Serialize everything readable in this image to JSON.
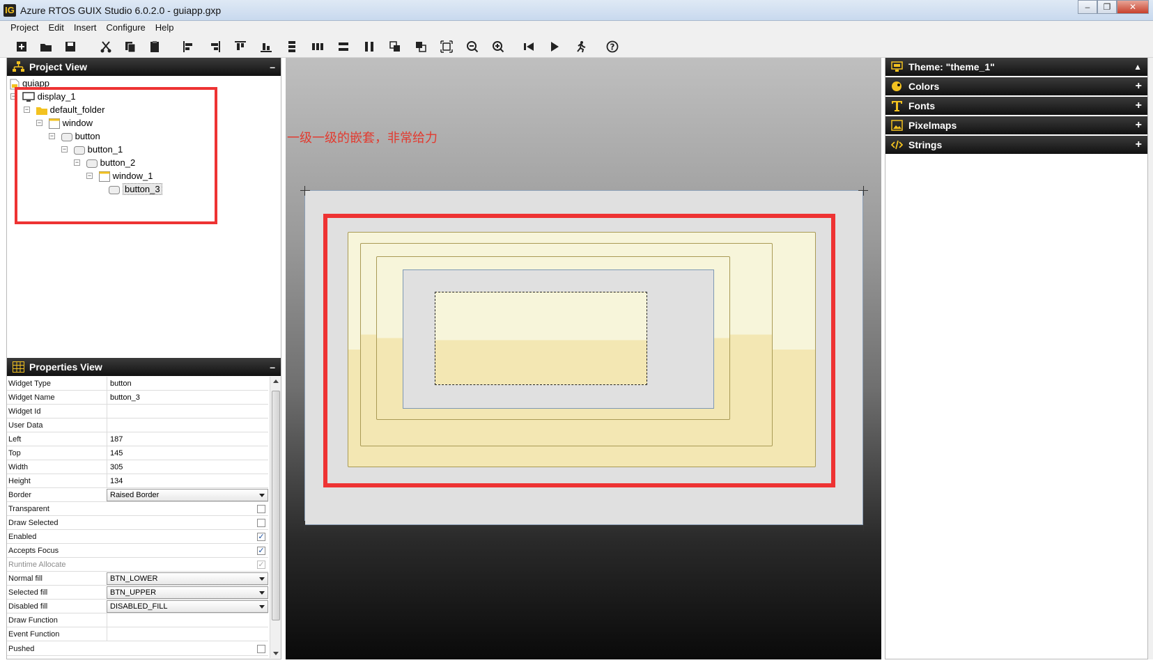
{
  "window": {
    "app_icon": "IG",
    "title": "Azure RTOS GUIX Studio 6.0.2.0 - guiapp.gxp",
    "controls": [
      "minimize",
      "restore",
      "close"
    ]
  },
  "menu": {
    "items": [
      "Project",
      "Edit",
      "Insert",
      "Configure",
      "Help"
    ]
  },
  "toolbar": {
    "buttons": [
      "new",
      "open",
      "save",
      "cut",
      "copy",
      "paste",
      "align-left",
      "align-right",
      "align-top",
      "align-bottom",
      "vspace-equally",
      "hspace-equally",
      "equal-height",
      "equal-width",
      "move-to-front",
      "move-to-back",
      "size-to-fit",
      "zoom-out",
      "zoom-in",
      "record-macro",
      "run",
      "run-app",
      "help"
    ]
  },
  "project_view": {
    "title": "Project View",
    "minimize": "–",
    "tree": [
      {
        "label": "guiapp",
        "icon": "project-icon"
      },
      {
        "label": "display_1",
        "icon": "display-icon"
      },
      {
        "label": "default_folder",
        "icon": "folder-icon"
      },
      {
        "label": "window",
        "icon": "window-icon"
      },
      {
        "label": "button",
        "icon": "button-icon"
      },
      {
        "label": "button_1",
        "icon": "button-icon"
      },
      {
        "label": "button_2",
        "icon": "button-icon"
      },
      {
        "label": "window_1",
        "icon": "window-icon"
      },
      {
        "label": "button_3",
        "icon": "button-icon"
      }
    ]
  },
  "properties_view": {
    "title": "Properties View",
    "minimize": "–",
    "rows": [
      {
        "name": "Widget Type",
        "value": "button",
        "kind": "text"
      },
      {
        "name": "Widget Name",
        "value": "button_3",
        "kind": "text"
      },
      {
        "name": "Widget Id",
        "value": "",
        "kind": "text"
      },
      {
        "name": "User Data",
        "value": "",
        "kind": "text"
      },
      {
        "name": "Left",
        "value": "187",
        "kind": "text"
      },
      {
        "name": "Top",
        "value": "145",
        "kind": "text"
      },
      {
        "name": "Width",
        "value": "305",
        "kind": "text"
      },
      {
        "name": "Height",
        "value": "134",
        "kind": "text"
      },
      {
        "name": "Border",
        "value": "Raised Border",
        "kind": "dropdown"
      },
      {
        "name": "Transparent",
        "value": "",
        "kind": "checkbox",
        "checked": false
      },
      {
        "name": "Draw Selected",
        "value": "",
        "kind": "checkbox",
        "checked": false
      },
      {
        "name": "Enabled",
        "value": "",
        "kind": "checkbox",
        "checked": true
      },
      {
        "name": "Accepts Focus",
        "value": "",
        "kind": "checkbox",
        "checked": true
      },
      {
        "name": "Runtime Allocate",
        "value": "",
        "kind": "checkbox",
        "checked": true,
        "disabled": true
      },
      {
        "name": "Normal fill",
        "value": "BTN_LOWER",
        "kind": "dropdown"
      },
      {
        "name": "Selected fill",
        "value": "BTN_UPPER",
        "kind": "dropdown"
      },
      {
        "name": "Disabled fill",
        "value": "DISABLED_FILL",
        "kind": "dropdown"
      },
      {
        "name": "Draw Function",
        "value": "",
        "kind": "text"
      },
      {
        "name": "Event Function",
        "value": "",
        "kind": "text"
      },
      {
        "name": "Pushed",
        "value": "",
        "kind": "checkbox",
        "checked": false
      }
    ]
  },
  "canvas": {
    "annotation_text": "一级一级的嵌套，非常给力",
    "annotation_color": "#e23a2f",
    "display_background": "#e0e0e0",
    "widget_upper_fill": "#f7f5da",
    "widget_lower_fill": "#f3e7b3"
  },
  "resources": {
    "theme_label": "Theme: \"theme_1\"",
    "sections": [
      {
        "label": "Colors",
        "icon": "palette-icon"
      },
      {
        "label": "Fonts",
        "icon": "font-icon"
      },
      {
        "label": "Pixelmaps",
        "icon": "image-icon"
      },
      {
        "label": "Strings",
        "icon": "code-icon"
      }
    ],
    "expand_symbol": "+",
    "accent": "#f3c220"
  }
}
